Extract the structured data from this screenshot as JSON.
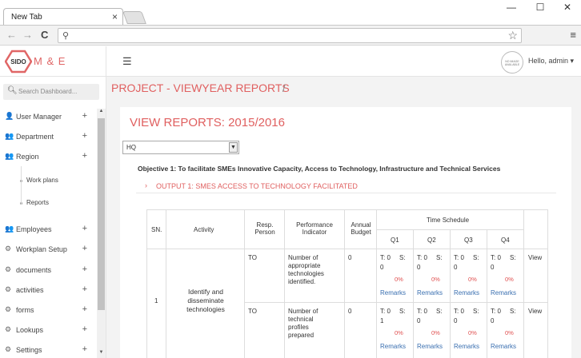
{
  "browser": {
    "tab_title": "New Tab",
    "tab_close": "×",
    "win_min": "—",
    "win_max": "☐",
    "win_close": "✕",
    "back": "←",
    "forward": "→",
    "reload": "C",
    "search_glyph": "⚲",
    "star": "☆",
    "menu": "≡"
  },
  "brand": {
    "logo_text": "SIDO",
    "app_name": "M & E",
    "logo_color": "#e06666"
  },
  "sidebar": {
    "search_placeholder": "Search Dashboard...",
    "items": [
      {
        "label": "User Manager",
        "icon": "user-icon",
        "glyph": "👤"
      },
      {
        "label": "Department",
        "icon": "users-icon",
        "glyph": "👥"
      },
      {
        "label": "Region",
        "icon": "users-icon",
        "glyph": "👥"
      },
      {
        "label": "Employees",
        "icon": "users-icon",
        "glyph": "👥"
      },
      {
        "label": "Workplan Setup",
        "icon": "gears-icon",
        "glyph": "⚙"
      },
      {
        "label": "documents",
        "icon": "gears-icon",
        "glyph": "⚙"
      },
      {
        "label": "activities",
        "icon": "gears-icon",
        "glyph": "⚙"
      },
      {
        "label": "forms",
        "icon": "gears-icon",
        "glyph": "⚙"
      },
      {
        "label": "Lookups",
        "icon": "gears-icon",
        "glyph": "⚙"
      },
      {
        "label": "Settings",
        "icon": "gears-icon",
        "glyph": "⚙"
      }
    ],
    "plus": "+",
    "subitems": [
      {
        "label": "Work plans"
      },
      {
        "label": "Reports"
      }
    ]
  },
  "topbar": {
    "avatar_text": "NO IMAGE AVAILABLE",
    "greeting": "Hello, admin",
    "caret": "▾"
  },
  "content": {
    "page_title": "PROJECT - VIEWYEAR REPORTS",
    "page_sep": "/",
    "panel_title": "VIEW REPORTS: 2015/2016",
    "select_value": "HQ",
    "objective": "Objective 1: To facilitate SMEs Innovative Capacity, Access to Technology, Infrastructure and Technical Services",
    "output_arrow": "›",
    "output": "OUTPUT 1: SMES ACCESS TO TECHNOLOGY FACILITATED"
  },
  "table": {
    "headers": {
      "sn": "SN.",
      "activity": "Activity",
      "resp": "Resp. Person",
      "indicator": "Performance Indicator",
      "budget": "Annual Budget",
      "schedule": "Time Schedule",
      "q1": "Q1",
      "q2": "Q2",
      "q3": "Q3",
      "q4": "Q4"
    },
    "row": {
      "sn": "1",
      "activity": "Identify and disseminate technologies",
      "subrows": [
        {
          "resp": "TO",
          "indicator": "Number of appropriate technologies identified.",
          "budget": "0",
          "quarters": [
            {
              "t": "T: 0",
              "s": "S:",
              "sv": "0",
              "pct": "0%",
              "remarks": "Remarks"
            },
            {
              "t": "T: 0",
              "s": "S:",
              "sv": "0",
              "pct": "0%",
              "remarks": "Remarks"
            },
            {
              "t": "T: 0",
              "s": "S:",
              "sv": "0",
              "pct": "0%",
              "remarks": "Remarks"
            },
            {
              "t": "T: 0",
              "s": "S:",
              "sv": "0",
              "pct": "0%",
              "remarks": "Remarks"
            }
          ],
          "view": "View"
        },
        {
          "resp": "TO",
          "indicator": "Number of technical profiles prepared",
          "budget": "0",
          "quarters": [
            {
              "t": "T: 0",
              "s": "S:",
              "sv": "1",
              "pct": "0%",
              "remarks": "Remarks"
            },
            {
              "t": "T: 0",
              "s": "S:",
              "sv": "0",
              "pct": "0%",
              "remarks": "Remarks"
            },
            {
              "t": "T: 0",
              "s": "S:",
              "sv": "0",
              "pct": "0%",
              "remarks": "Remarks"
            },
            {
              "t": "T: 0",
              "s": "S:",
              "sv": "0",
              "pct": "0%",
              "remarks": "Remarks"
            }
          ],
          "view": "View"
        }
      ]
    }
  },
  "colors": {
    "accent": "#e06060",
    "link": "#3a6fb0"
  }
}
